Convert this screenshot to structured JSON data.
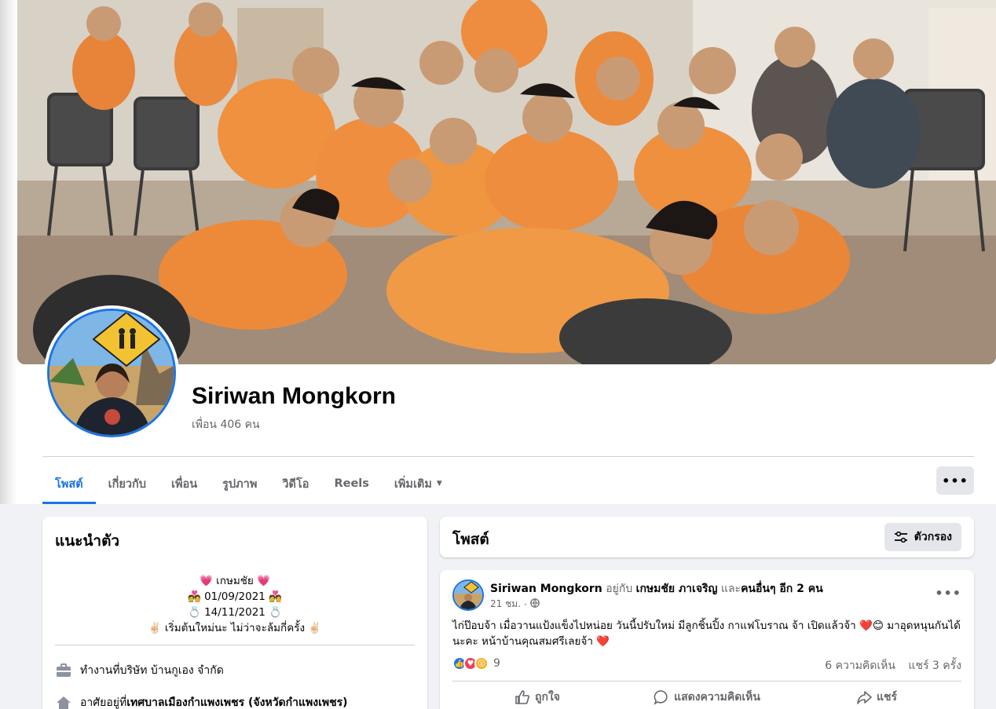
{
  "profile": {
    "name": "Siriwan Mongkorn",
    "friends": "เพื่อน 406 คน"
  },
  "tabs": [
    {
      "label": "โพสต์"
    },
    {
      "label": "เกี่ยวกับ"
    },
    {
      "label": "เพื่อน"
    },
    {
      "label": "รูปภาพ"
    },
    {
      "label": "วิดีโอ"
    },
    {
      "label": "Reels"
    },
    {
      "label": "เพิ่มเติม"
    }
  ],
  "more_button": "•••",
  "intro": {
    "title": "แนะนำตัว",
    "bio": [
      "💗 เกษมชัย 💗",
      "💑 01/09/2021 💑",
      "💍 14/11/2021 💍",
      "✌🏻 เริ่มต้นใหม่นะ ไม่ว่าจะล้มกี่ครั้ง ✌🏻"
    ],
    "work_prefix": "ทำงานที่ ",
    "work_value": "บริษัท บ้านกูเอง จำกัด",
    "lives_prefix": "อาศัยอยู่ที่ ",
    "lives_value": "เทศบาลเมืองกำแพงเพชร (จังหวัดกำแพงเพชร)"
  },
  "posts_section": {
    "title": "โพสต์",
    "filter_label": "ตัวกรอง"
  },
  "post": {
    "author": "Siriwan Mongkorn",
    "with_text": " อยู่กับ ",
    "tagged": "เกษมชัย ภาเจริญ",
    "and_text": " และ",
    "others": "คนอื่นๆ อีก 2 คน",
    "time": "21 ชม.",
    "dot": "·",
    "text": "ไก่ป๊อบจ้า เมื่อวานแป้งแข็งไปหน่อย วันนี้ปรับใหม่ มีลูกชิ้นปิ้ง กาแฟโบราณ จ้า เปิดแล้วจ้า ❤️😊 มาอุดหนุนกันได้นะคะ หน้าบ้านคุณสมศรีเลยจ้า ❤️",
    "reaction_count": "9",
    "comments": "6 ความคิดเห็น",
    "shares": "แชร์ 3 ครั้ง",
    "actions": {
      "like": "ถูกใจ",
      "comment": "แสดงความคิดเห็น",
      "share": "แชร์"
    }
  },
  "colors": {
    "accent": "#1b74e4",
    "background": "#f0f2f5",
    "secondary_text": "#65676b"
  }
}
